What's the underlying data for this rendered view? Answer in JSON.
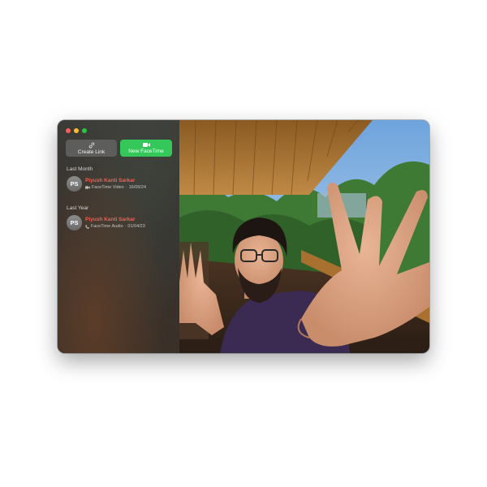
{
  "window": {
    "controls": [
      "close",
      "minimize",
      "zoom"
    ]
  },
  "toolbar": {
    "create_link_label": "Create Link",
    "create_link_icon": "link-icon",
    "new_facetime_label": "New FaceTime",
    "new_facetime_icon": "video-camera-icon"
  },
  "recents": [
    {
      "section": "Last Month",
      "items": [
        {
          "initials": "PS",
          "name": "Piyush Kanti Sarkar",
          "type": "FaceTime Video",
          "date": "16/09/24",
          "type_icon": "video-camera-icon"
        }
      ]
    },
    {
      "section": "Last Year",
      "items": [
        {
          "initials": "PS",
          "name": "Piyush Kanti Sarkar",
          "type": "FaceTime Audio",
          "date": "01/04/23",
          "type_icon": "phone-icon"
        }
      ]
    }
  ],
  "colors": {
    "accent_green": "#34c759",
    "missed_red": "#ff5b4f",
    "sidebar_bg": "#3c3b37"
  }
}
